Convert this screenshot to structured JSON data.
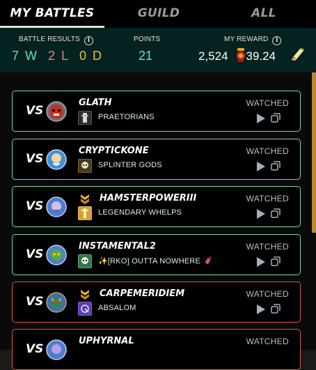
{
  "tabs": [
    {
      "label": "MY BATTLES"
    },
    {
      "label": "GUILD"
    },
    {
      "label": "ALL"
    }
  ],
  "stats": {
    "battle_results_label": "BATTLE RESULTS",
    "points_label": "POINTS",
    "reward_label": "MY REWARD",
    "wins": "7 W",
    "losses": "2 L",
    "draws": "0 D",
    "points": "21",
    "reward_dec": "2,524",
    "reward_sps": "39.24"
  },
  "vs_label": "VS",
  "watched_label": "WATCHED",
  "battles": [
    {
      "player": "GLATH",
      "guild": "PRAETORIANS",
      "result": "win",
      "avatar": "red-skull-avatar",
      "guild_icon": "knight-banner-icon"
    },
    {
      "player": "CRYPTICKONE",
      "guild": "SPLINTER GODS",
      "result": "win",
      "avatar": "angel-avatar",
      "guild_icon": "skull-banner-icon"
    },
    {
      "player": "HAMSTERPOWERIII",
      "guild": "LEGENDARY WHELPS",
      "result": "win",
      "avatar": "wizard-avatar",
      "guild_icon": "gold-banner-icon"
    },
    {
      "player": "INSTAMENTAL2",
      "guild": "✨[RKO] OUTTA NOWHERE",
      "result": "win",
      "avatar": "goblin-avatar",
      "guild_icon": "green-skull-banner-icon"
    },
    {
      "player": "CARPEMERIDIEM",
      "guild": "ABSALOM",
      "result": "loss",
      "avatar": "beast-avatar",
      "guild_icon": "purple-banner-icon"
    },
    {
      "player": "UPHYRNAL",
      "guild": "",
      "result": "loss",
      "avatar": "mage-avatar",
      "guild_icon": ""
    }
  ],
  "colors": {
    "win_border": "#7fd9a0",
    "loss_border": "#e2554a",
    "wins": "#5ee6b6",
    "losses": "#f27aa0",
    "draws": "#f1c232"
  }
}
